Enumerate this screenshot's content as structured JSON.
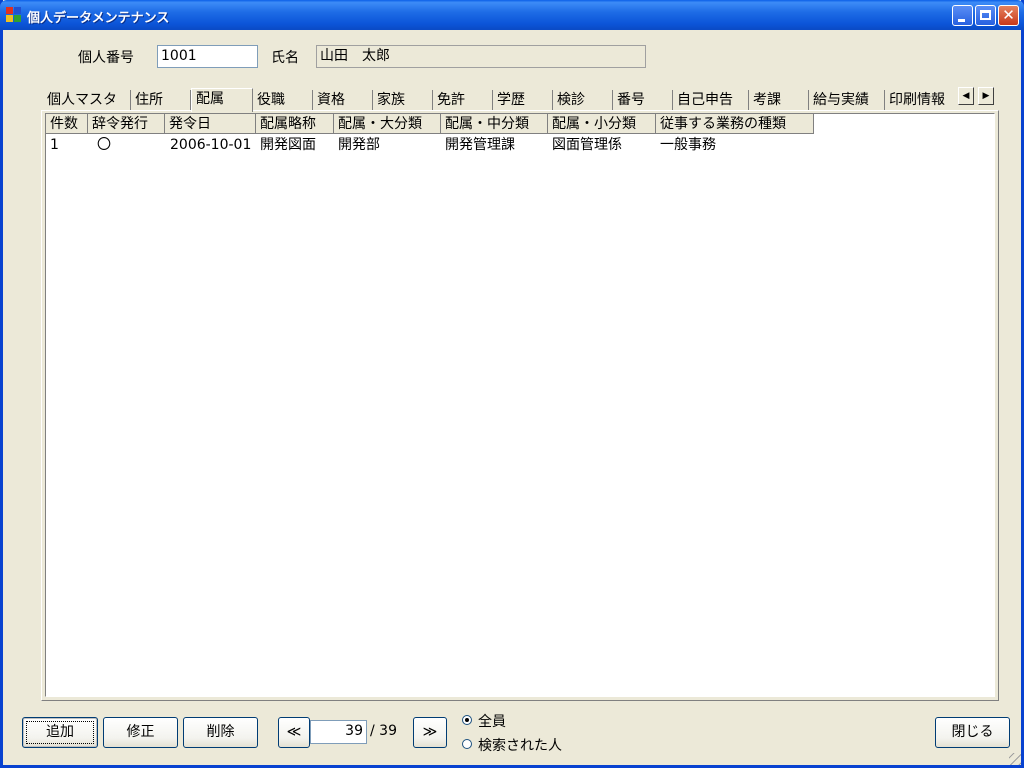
{
  "window": {
    "title": "個人データメンテナンス"
  },
  "header": {
    "id_label": "個人番号",
    "id_value": "1001",
    "name_label": "氏名",
    "name_value": "山田　太郎"
  },
  "tabs": [
    {
      "label": "個人マスタ",
      "active": false
    },
    {
      "label": "住所",
      "active": false
    },
    {
      "label": "配属",
      "active": true
    },
    {
      "label": "役職",
      "active": false
    },
    {
      "label": "資格",
      "active": false
    },
    {
      "label": "家族",
      "active": false
    },
    {
      "label": "免許",
      "active": false
    },
    {
      "label": "学歴",
      "active": false
    },
    {
      "label": "検診",
      "active": false
    },
    {
      "label": "番号",
      "active": false
    },
    {
      "label": "自己申告",
      "active": false
    },
    {
      "label": "考課",
      "active": false
    },
    {
      "label": "給与実績",
      "active": false
    },
    {
      "label": "印刷情報",
      "active": false
    }
  ],
  "grid": {
    "columns": [
      "件数",
      "辞令発行",
      "発令日",
      "配属略称",
      "配属・大分類",
      "配属・中分類",
      "配属・小分類",
      "従事する業務の種類"
    ],
    "rows": [
      [
        "1",
        "〇",
        "2006-10-01",
        "開発図面",
        "開発部",
        "開発管理課",
        "図面管理係",
        "一般事務"
      ]
    ]
  },
  "footer": {
    "add_label": "追加",
    "edit_label": "修正",
    "delete_label": "削除",
    "prev_label": "≪",
    "current_page": "39",
    "total_pages": "/ 39",
    "next_label": "≫",
    "radio_all_label": "全員",
    "radio_search_label": "検索された人",
    "radio_selected": "全員",
    "close_label": "閉じる"
  }
}
